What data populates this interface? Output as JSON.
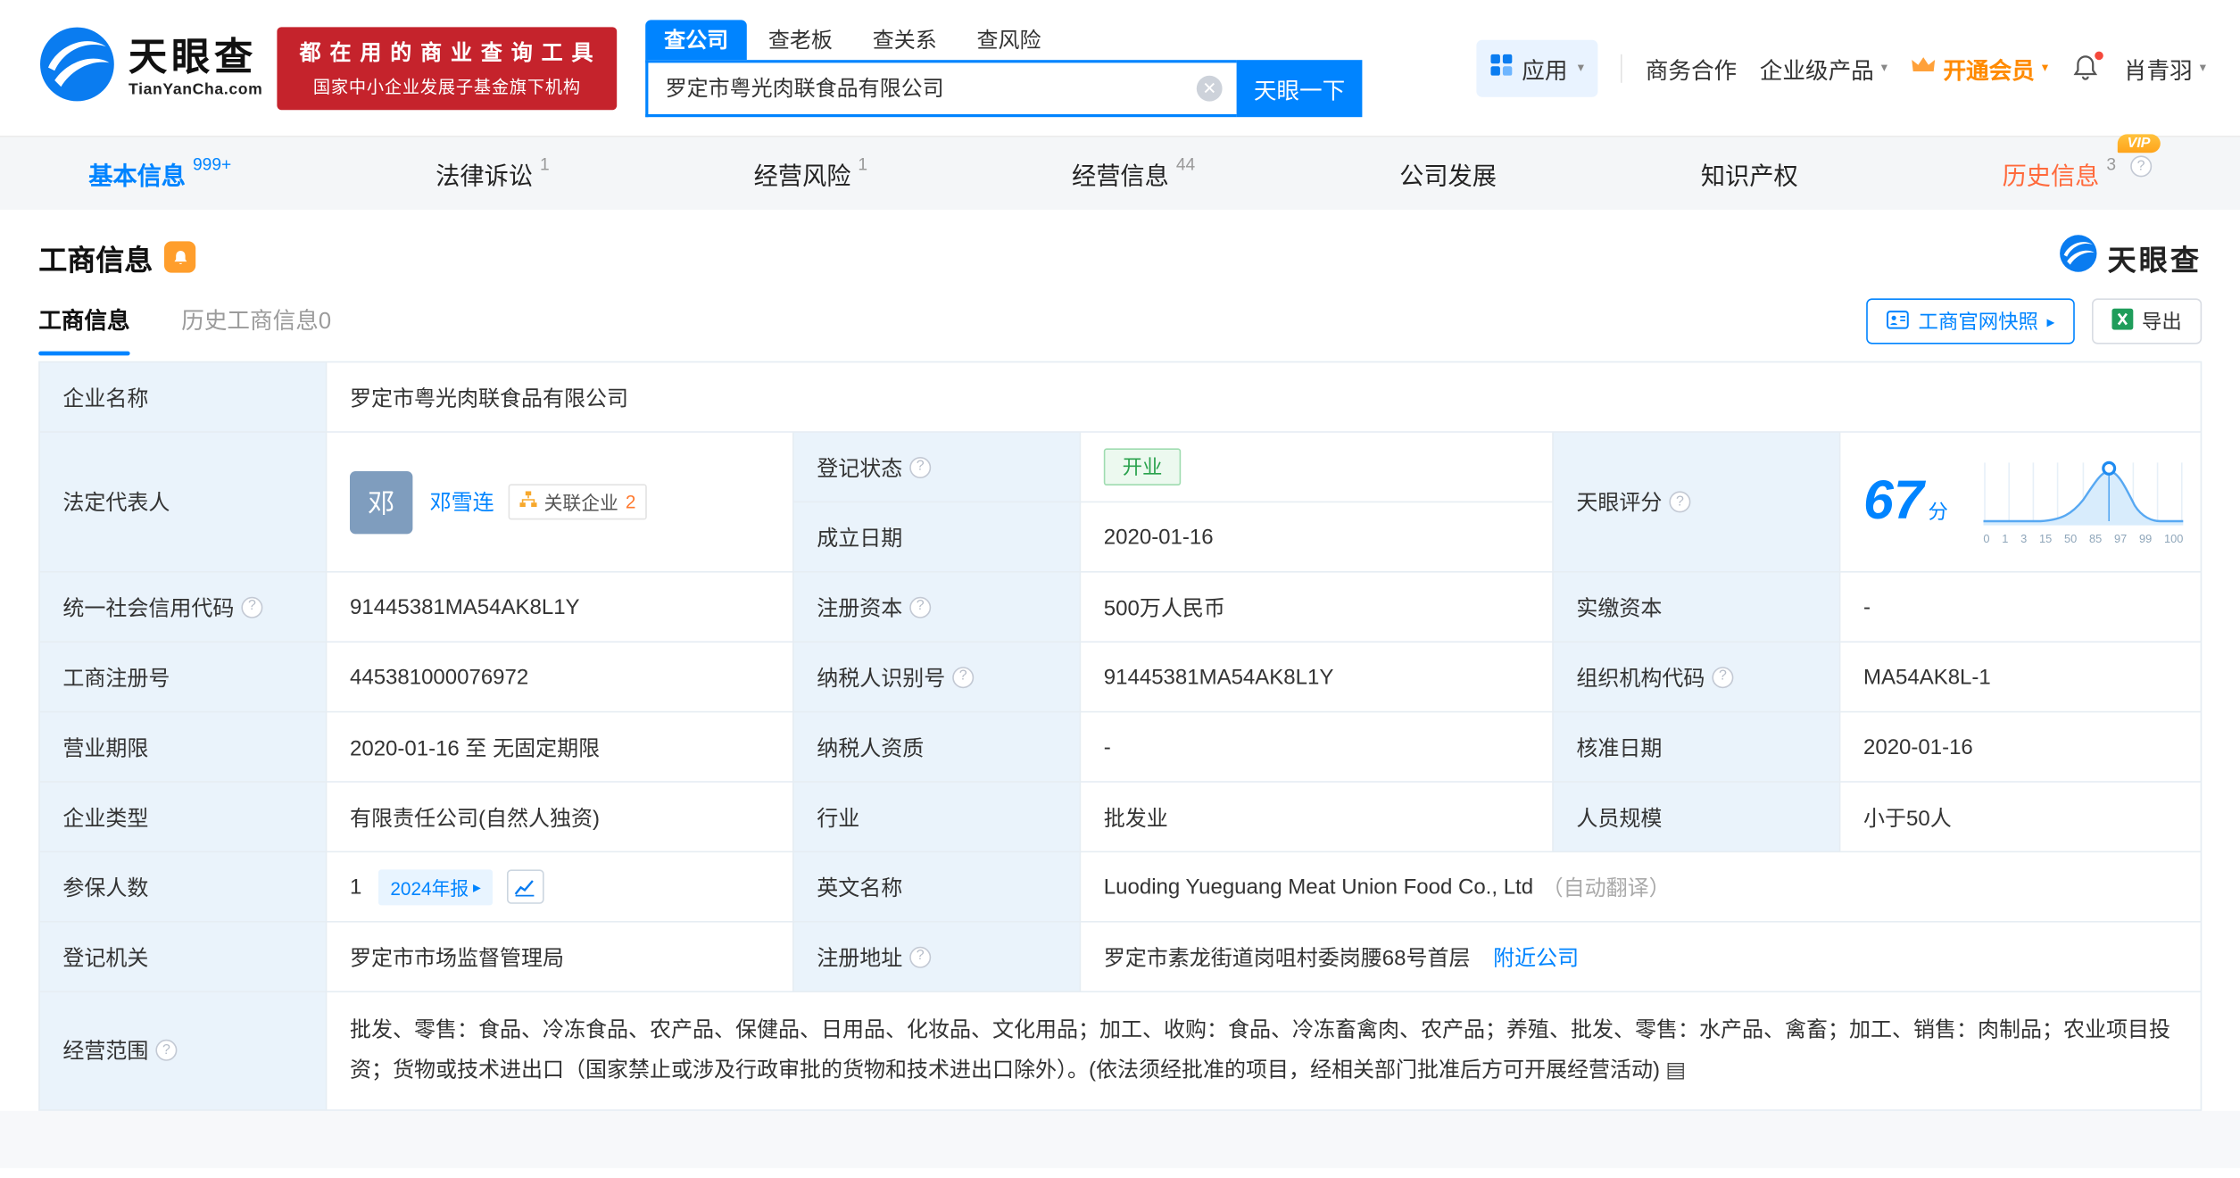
{
  "brand": {
    "name": "天眼查",
    "domain": "TianYanCha.com",
    "blue": "#0084ff"
  },
  "header": {
    "promo": {
      "line1": "都 在 用 的 商 业 查 询 工 具",
      "line2": "国家中小企业发展子基金旗下机构"
    },
    "search": {
      "tabs": [
        {
          "label": "查公司"
        },
        {
          "label": "查老板"
        },
        {
          "label": "查关系"
        },
        {
          "label": "查风险"
        }
      ],
      "value": "罗定市粤光肉联食品有限公司",
      "button": "天眼一下"
    },
    "right": {
      "apps": "应用",
      "cooperation": "商务合作",
      "enterprise": "企业级产品",
      "vip": "开通会员",
      "username": "肖青羽"
    }
  },
  "tabs": [
    {
      "label": "基本信息",
      "count": "999+"
    },
    {
      "label": "法律诉讼",
      "count": "1"
    },
    {
      "label": "经营风险",
      "count": "1"
    },
    {
      "label": "经营信息",
      "count": "44"
    },
    {
      "label": "公司发展",
      "count": ""
    },
    {
      "label": "知识产权",
      "count": ""
    },
    {
      "label": "历史信息",
      "count": "3",
      "vip_badge": "VIP"
    }
  ],
  "section": {
    "title": "工商信息",
    "watermark": "天眼查",
    "subtabs": [
      {
        "label": "工商信息"
      },
      {
        "label": "历史工商信息",
        "count": "0"
      }
    ],
    "snapshot_button": "工商官网快照",
    "export_button": "导出"
  },
  "table": {
    "company_name_label": "企业名称",
    "company_name": "罗定市粤光肉联食品有限公司",
    "legal_rep_label": "法定代表人",
    "legal_rep_avatar": "邓",
    "legal_rep_name": "邓雪连",
    "related_badge": "关联企业",
    "related_count": "2",
    "reg_status_label": "登记状态",
    "reg_status": "开业",
    "establish_date_label": "成立日期",
    "establish_date": "2020-01-16",
    "score_label": "天眼评分",
    "score_value": "67",
    "score_unit": "分",
    "score_axis": [
      "0",
      "1",
      "3",
      "15",
      "50",
      "85",
      "97",
      "99",
      "100"
    ],
    "credit_code_label": "统一社会信用代码",
    "credit_code": "91445381MA54AK8L1Y",
    "reg_capital_label": "注册资本",
    "reg_capital": "500万人民币",
    "paid_capital_label": "实缴资本",
    "paid_capital": "-",
    "reg_number_label": "工商注册号",
    "reg_number": "445381000076972",
    "taxpayer_id_label": "纳税人识别号",
    "taxpayer_id": "91445381MA54AK8L1Y",
    "org_code_label": "组织机构代码",
    "org_code": "MA54AK8L-1",
    "term_label": "营业期限",
    "term": "2020-01-16 至 无固定期限",
    "taxpayer_quality_label": "纳税人资质",
    "taxpayer_quality": "-",
    "approval_date_label": "核准日期",
    "approval_date": "2020-01-16",
    "type_label": "企业类型",
    "type": "有限责任公司(自然人独资)",
    "industry_label": "行业",
    "industry": "批发业",
    "staff_label": "人员规模",
    "staff": "小于50人",
    "insured_label": "参保人数",
    "insured_value": "1",
    "annual_report": "2024年报",
    "english_label": "英文名称",
    "english_name": "Luoding Yueguang Meat Union Food Co., Ltd",
    "english_note": "（自动翻译）",
    "authority_label": "登记机关",
    "authority": "罗定市市场监督管理局",
    "address_label": "注册地址",
    "address": "罗定市素龙街道岗咀村委岗腰68号首层",
    "nearby": "附近公司",
    "scope_label": "经营范围",
    "scope": "批发、零售：食品、冷冻食品、农产品、保健品、日用品、化妆品、文化用品；加工、收购：食品、冷冻畜禽肉、农产品；养殖、批发、零售：水产品、禽畜；加工、销售：肉制品；农业项目投资；货物或技术进出口（国家禁止或涉及行政审批的货物和技术进出口除外）。(依法须经批准的项目，经相关部门批准后方可开展经营活动)"
  }
}
